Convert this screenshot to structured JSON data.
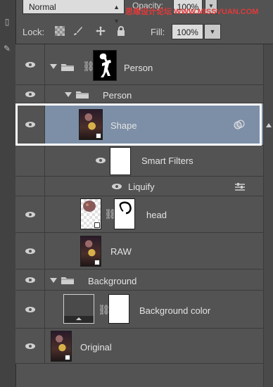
{
  "toolbar": {
    "blend_mode": "Normal",
    "opacity_label": "Opacity:",
    "opacity_value": "100%",
    "watermark": "思缘设计论坛 WWW.MISSVUAN.COM",
    "lock_label": "Lock:",
    "fill_label": "Fill:",
    "fill_value": "100%"
  },
  "icons": {
    "visibility": "eye-icon",
    "disclosure": "triangle-down-icon",
    "group": "folder-icon",
    "link": "chain-link-icon",
    "smart_object": "smart-object-badge-icon",
    "filter_options": "filter-blending-options-icon",
    "scroll_up": "scroll-up-arrow-icon"
  },
  "layers": [
    {
      "name": "Person",
      "type": "group-with-mask"
    },
    {
      "name": "Person",
      "type": "group"
    },
    {
      "name": "Shape",
      "type": "smart-object",
      "selected": true
    },
    {
      "name": "Smart Filters",
      "type": "smart-filters-mask"
    },
    {
      "name": "Liquify",
      "type": "filter"
    },
    {
      "name": "head",
      "type": "smart-object-with-mask"
    },
    {
      "name": "RAW",
      "type": "smart-object"
    },
    {
      "name": "Background",
      "type": "group"
    },
    {
      "name": "Background color",
      "type": "fill-layer-with-mask"
    },
    {
      "name": "Original",
      "type": "smart-object"
    }
  ],
  "colors": {
    "panel_bg": "#535353",
    "selected_row": "#7d8fa7",
    "highlight_outline": "#ffffff",
    "watermark": "#e03a3a"
  }
}
